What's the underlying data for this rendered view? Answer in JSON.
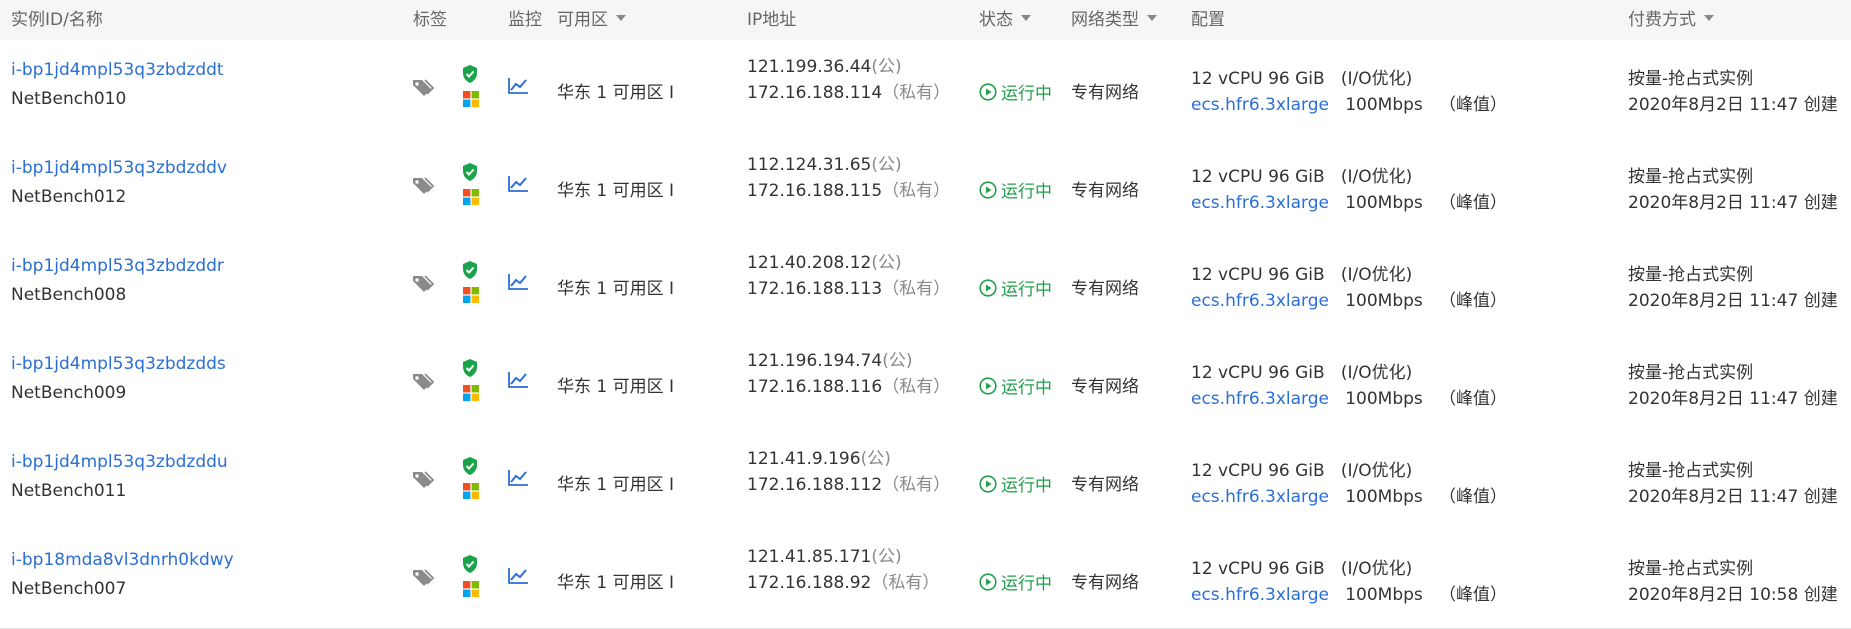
{
  "header": {
    "id_name": "实例ID/名称",
    "tags": "标签",
    "monitor": "监控",
    "zone": "可用区",
    "ip": "IP地址",
    "status": "状态",
    "network_type": "网络类型",
    "config": "配置",
    "billing": "付费方式"
  },
  "colors": {
    "link": "#2a6fd6",
    "running": "#22a04b",
    "shield": "#1aa34a",
    "header_bg": "#f5f6f7"
  },
  "icons": [
    "tag-icon",
    "security-shield-icon",
    "windows-os-icon",
    "monitor-chart-icon",
    "play-circle-icon",
    "caret-down-icon"
  ],
  "rows": [
    {
      "id": "i-bp1jd4mpl53q3zbdzddt",
      "name": "NetBench010",
      "zone": "华东 1 可用区 I",
      "public_ip": "121.199.36.44",
      "public_label": "(公)",
      "private_ip": "172.16.188.114",
      "private_label": "（私有）",
      "status": "运行中",
      "network": "专有网络",
      "spec": "12 vCPU 96 GiB",
      "io": "(I/O优化)",
      "instance_type": "ecs.hfr6.3xlarge",
      "bandwidth": "100Mbps",
      "bandwidth_note": "（峰值）",
      "billing": "按量-抢占式实例",
      "created": "2020年8月2日 11:47 创建"
    },
    {
      "id": "i-bp1jd4mpl53q3zbdzddv",
      "name": "NetBench012",
      "zone": "华东 1 可用区 I",
      "public_ip": "112.124.31.65",
      "public_label": "(公)",
      "private_ip": "172.16.188.115",
      "private_label": "（私有）",
      "status": "运行中",
      "network": "专有网络",
      "spec": "12 vCPU 96 GiB",
      "io": "(I/O优化)",
      "instance_type": "ecs.hfr6.3xlarge",
      "bandwidth": "100Mbps",
      "bandwidth_note": "（峰值）",
      "billing": "按量-抢占式实例",
      "created": "2020年8月2日 11:47 创建"
    },
    {
      "id": "i-bp1jd4mpl53q3zbdzddr",
      "name": "NetBench008",
      "zone": "华东 1 可用区 I",
      "public_ip": "121.40.208.12",
      "public_label": "(公)",
      "private_ip": "172.16.188.113",
      "private_label": "（私有）",
      "status": "运行中",
      "network": "专有网络",
      "spec": "12 vCPU 96 GiB",
      "io": "(I/O优化)",
      "instance_type": "ecs.hfr6.3xlarge",
      "bandwidth": "100Mbps",
      "bandwidth_note": "（峰值）",
      "billing": "按量-抢占式实例",
      "created": "2020年8月2日 11:47 创建"
    },
    {
      "id": "i-bp1jd4mpl53q3zbdzdds",
      "name": "NetBench009",
      "zone": "华东 1 可用区 I",
      "public_ip": "121.196.194.74",
      "public_label": "(公)",
      "private_ip": "172.16.188.116",
      "private_label": "（私有）",
      "status": "运行中",
      "network": "专有网络",
      "spec": "12 vCPU 96 GiB",
      "io": "(I/O优化)",
      "instance_type": "ecs.hfr6.3xlarge",
      "bandwidth": "100Mbps",
      "bandwidth_note": "（峰值）",
      "billing": "按量-抢占式实例",
      "created": "2020年8月2日 11:47 创建"
    },
    {
      "id": "i-bp1jd4mpl53q3zbdzddu",
      "name": "NetBench011",
      "zone": "华东 1 可用区 I",
      "public_ip": "121.41.9.196",
      "public_label": "(公)",
      "private_ip": "172.16.188.112",
      "private_label": "（私有）",
      "status": "运行中",
      "network": "专有网络",
      "spec": "12 vCPU 96 GiB",
      "io": "(I/O优化)",
      "instance_type": "ecs.hfr6.3xlarge",
      "bandwidth": "100Mbps",
      "bandwidth_note": "（峰值）",
      "billing": "按量-抢占式实例",
      "created": "2020年8月2日 11:47 创建"
    },
    {
      "id": "i-bp18mda8vl3dnrh0kdwy",
      "name": "NetBench007",
      "zone": "华东 1 可用区 I",
      "public_ip": "121.41.85.171",
      "public_label": "(公)",
      "private_ip": "172.16.188.92",
      "private_label": "（私有）",
      "status": "运行中",
      "network": "专有网络",
      "spec": "12 vCPU 96 GiB",
      "io": "(I/O优化)",
      "instance_type": "ecs.hfr6.3xlarge",
      "bandwidth": "100Mbps",
      "bandwidth_note": "（峰值）",
      "billing": "按量-抢占式实例",
      "created": "2020年8月2日 10:58 创建"
    }
  ]
}
